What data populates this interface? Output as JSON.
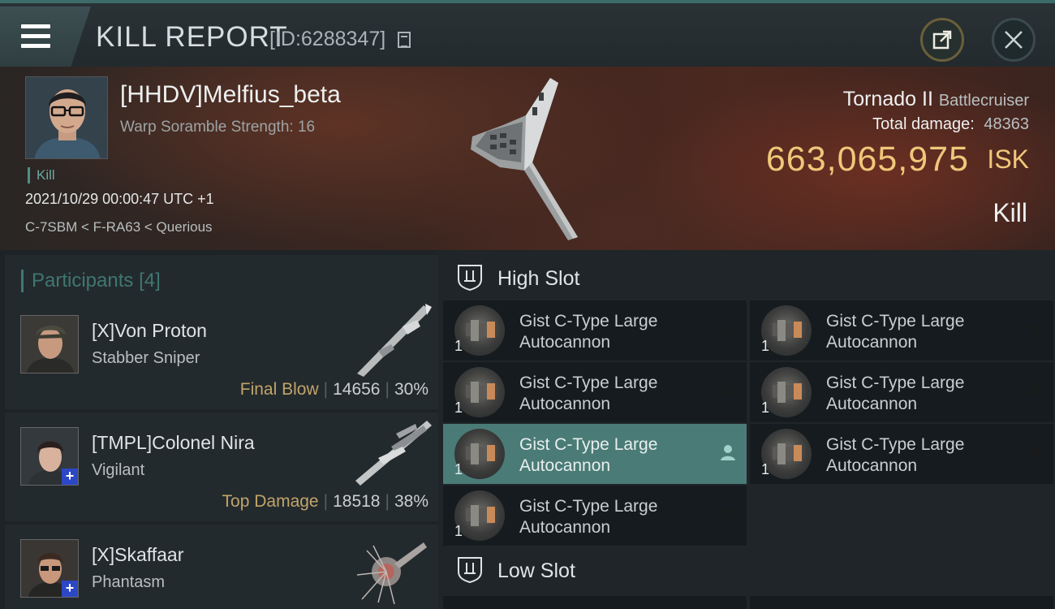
{
  "header": {
    "title": "KILL REPORT",
    "id_label": "[ID:6288347]"
  },
  "victim": {
    "name": "[HHDV]Melfius_beta",
    "scramble": "Warp Soramble Strength: 16",
    "tag": "Kill",
    "time": "2021/10/29 00:00:47 UTC +1",
    "location": "C-7SBM < F-RA63 < Querious",
    "ship": "Tornado II",
    "ship_class": "Battlecruiser",
    "total_damage_label": "Total damage:",
    "total_damage": "48363",
    "isk_value": "663,065,975",
    "isk_unit": "ISK",
    "kill_type": "Kill"
  },
  "participants": {
    "title": "Participants",
    "count": "[4]",
    "rows": [
      {
        "name": "[X]Von Proton",
        "ship": "Stabber Sniper",
        "tag": "Final Blow",
        "damage": "14656",
        "percent": "30%"
      },
      {
        "name": "[TMPL]Colonel Nira",
        "ship": "Vigilant",
        "tag": "Top Damage",
        "damage": "18518",
        "percent": "38%"
      },
      {
        "name": "[X]Skaffaar",
        "ship": "Phantasm"
      }
    ]
  },
  "fittings": {
    "high_slot_title": "High Slot",
    "low_slot_title": "Low Slot",
    "module_name_line1": "Gist C-Type Large",
    "module_name_line2": "Autocannon",
    "quantity": "1"
  },
  "colors": {
    "accent_teal": "#4a7b77",
    "isk_gold": "#f0c77a",
    "tag_gold": "#c2a46a"
  },
  "icons": [
    "menu-icon",
    "copy-icon",
    "share-icon",
    "close-icon",
    "high-slot-icon",
    "low-slot-icon",
    "remove-icon",
    "user-icon"
  ]
}
